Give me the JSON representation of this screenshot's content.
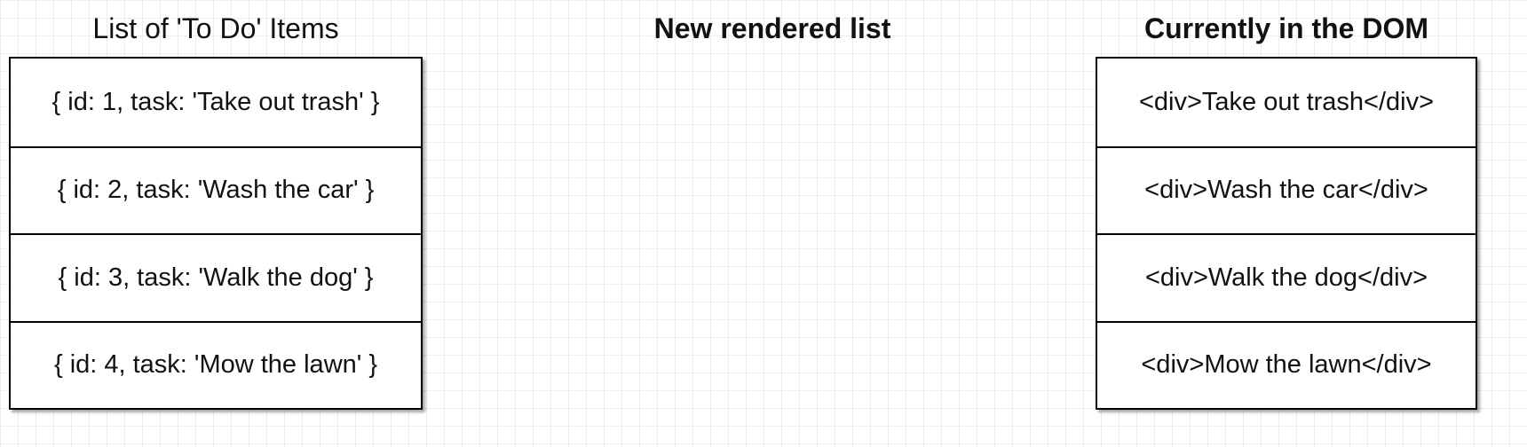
{
  "headings": {
    "todo_list": "List of 'To Do' Items",
    "new_rendered_list": "New rendered list",
    "current_dom": "Currently in the DOM"
  },
  "todo_items": [
    "{ id: 1, task: 'Take out trash' }",
    "{ id: 2, task: 'Wash the car' }",
    "{ id: 3, task: 'Walk the dog' }",
    "{ id: 4, task: 'Mow the lawn' }"
  ],
  "dom_items": [
    "<div>Take out trash</div>",
    "<div>Wash the car</div>",
    "<div>Walk the dog</div>",
    "<div>Mow the lawn</div>"
  ]
}
